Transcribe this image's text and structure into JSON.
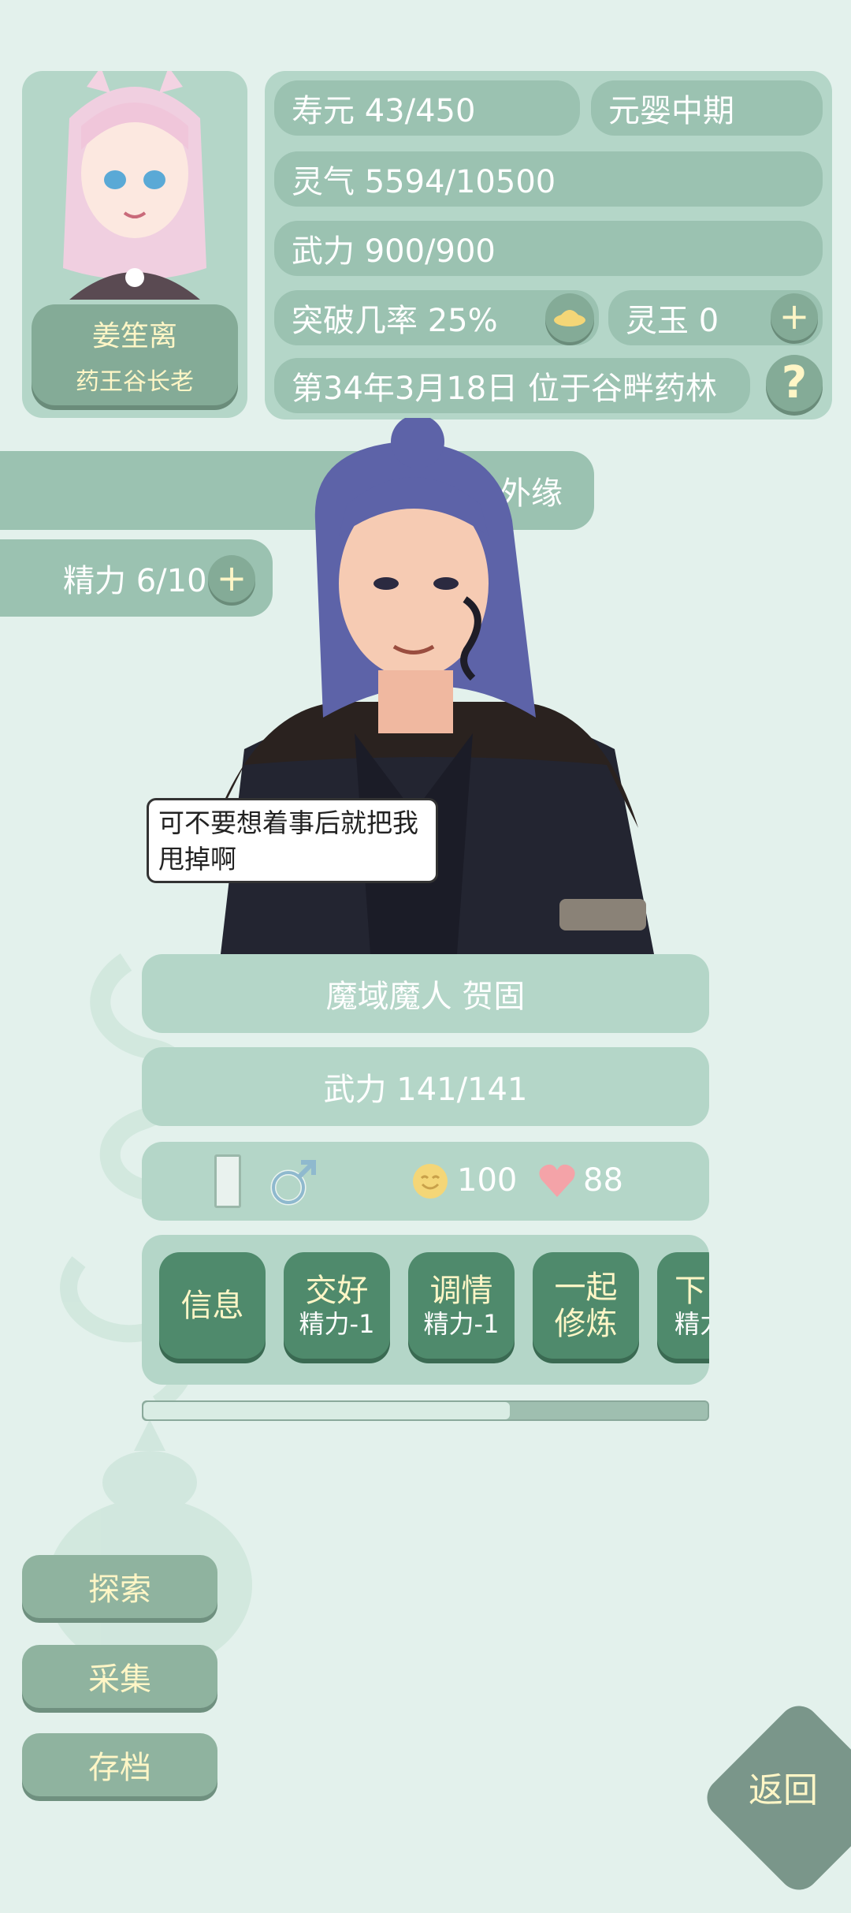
{
  "player": {
    "name": "姜笙离",
    "title": "药王谷长老"
  },
  "stats": {
    "lifespan": "寿元 43/450",
    "realm": "元婴中期",
    "qi": "灵气 5594/10500",
    "power": "武力 900/900",
    "breakthrough": "突破几率 25%",
    "jade": "灵玉 0",
    "date_location": "第34年3月18日 位于谷畔药林"
  },
  "side": {
    "banner_text": "外缘",
    "energy": "精力 6/10"
  },
  "speech": "可不要想着事后就把我甩掉啊",
  "npc": {
    "name": "魔域魔人 贺固",
    "power": "武力 141/141",
    "mood": "100",
    "affection": "88"
  },
  "actions": [
    {
      "title": "信息",
      "sub": ""
    },
    {
      "title": "交好",
      "sub": "精力-1"
    },
    {
      "title": "调情",
      "sub": "精力-1"
    },
    {
      "title": "一起修炼",
      "sub": ""
    },
    {
      "title": "下",
      "sub": "精力"
    }
  ],
  "scroll": {
    "fraction": 0.65
  },
  "menu": {
    "explore": "探索",
    "gather": "采集",
    "save": "存档"
  },
  "back": "返回",
  "colors": {
    "background": "#e3f1ec",
    "pill": "#9bc2b1",
    "action_green": "#4f8a6c",
    "gold_text": "#fff6c6",
    "heart": "#f4a3a8"
  }
}
